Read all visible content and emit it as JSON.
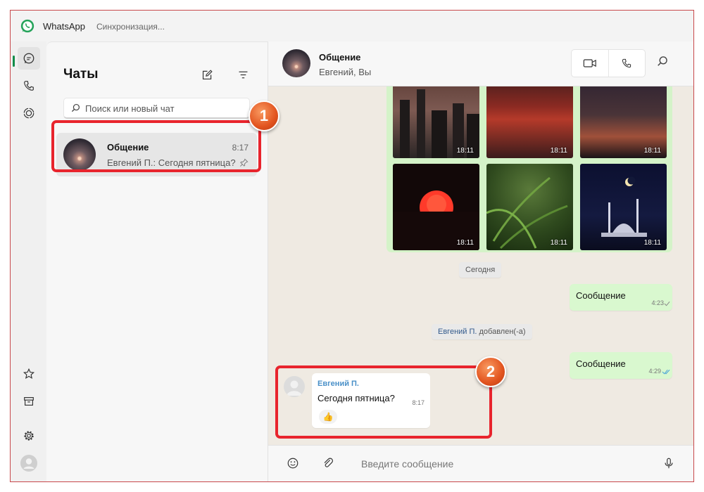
{
  "titlebar": {
    "app_name": "WhatsApp",
    "status": "Синхронизация..."
  },
  "rail": {
    "top_items": [
      {
        "icon": "chats-icon",
        "active": true
      },
      {
        "icon": "calls-icon"
      },
      {
        "icon": "status-icon"
      }
    ],
    "bottom_items": [
      {
        "icon": "starred-icon"
      },
      {
        "icon": "archive-icon"
      },
      {
        "icon": "settings-icon"
      },
      {
        "icon": "profile-avatar"
      }
    ]
  },
  "chat_list": {
    "title": "Чаты",
    "search_placeholder": "Поиск или новый чат",
    "items": [
      {
        "name": "Общение",
        "time": "8:17",
        "preview": "Евгений П.: Сегодня пятница?",
        "pinned": true
      }
    ]
  },
  "conversation": {
    "name": "Общение",
    "participants": "Евгений, Вы",
    "photos": [
      {
        "time": "18:11"
      },
      {
        "time": "18:11"
      },
      {
        "time": "18:11"
      },
      {
        "time": "18:11"
      },
      {
        "time": "18:11"
      },
      {
        "time": "18:11"
      }
    ],
    "date_divider": "Сегодня",
    "messages": [
      {
        "text": "Сообщение",
        "time": "4:23"
      },
      {
        "text": "Сообщение",
        "time": "4:29"
      }
    ],
    "system_notice": {
      "name": "Евгений П.",
      "action": "добавлен(-а)"
    },
    "incoming": {
      "sender": "Евгений П.",
      "text": "Сегодня пятница?",
      "time": "8:17",
      "reaction": "👍"
    },
    "composer_placeholder": "Введите сообщение"
  },
  "annotations": {
    "badge_1": "1",
    "badge_2": "2"
  },
  "colors": {
    "accent": "#128c4a",
    "outgoing_bubble": "#d9f8cf",
    "callout": "#e8242d",
    "sender_name": "#4a90c8"
  }
}
